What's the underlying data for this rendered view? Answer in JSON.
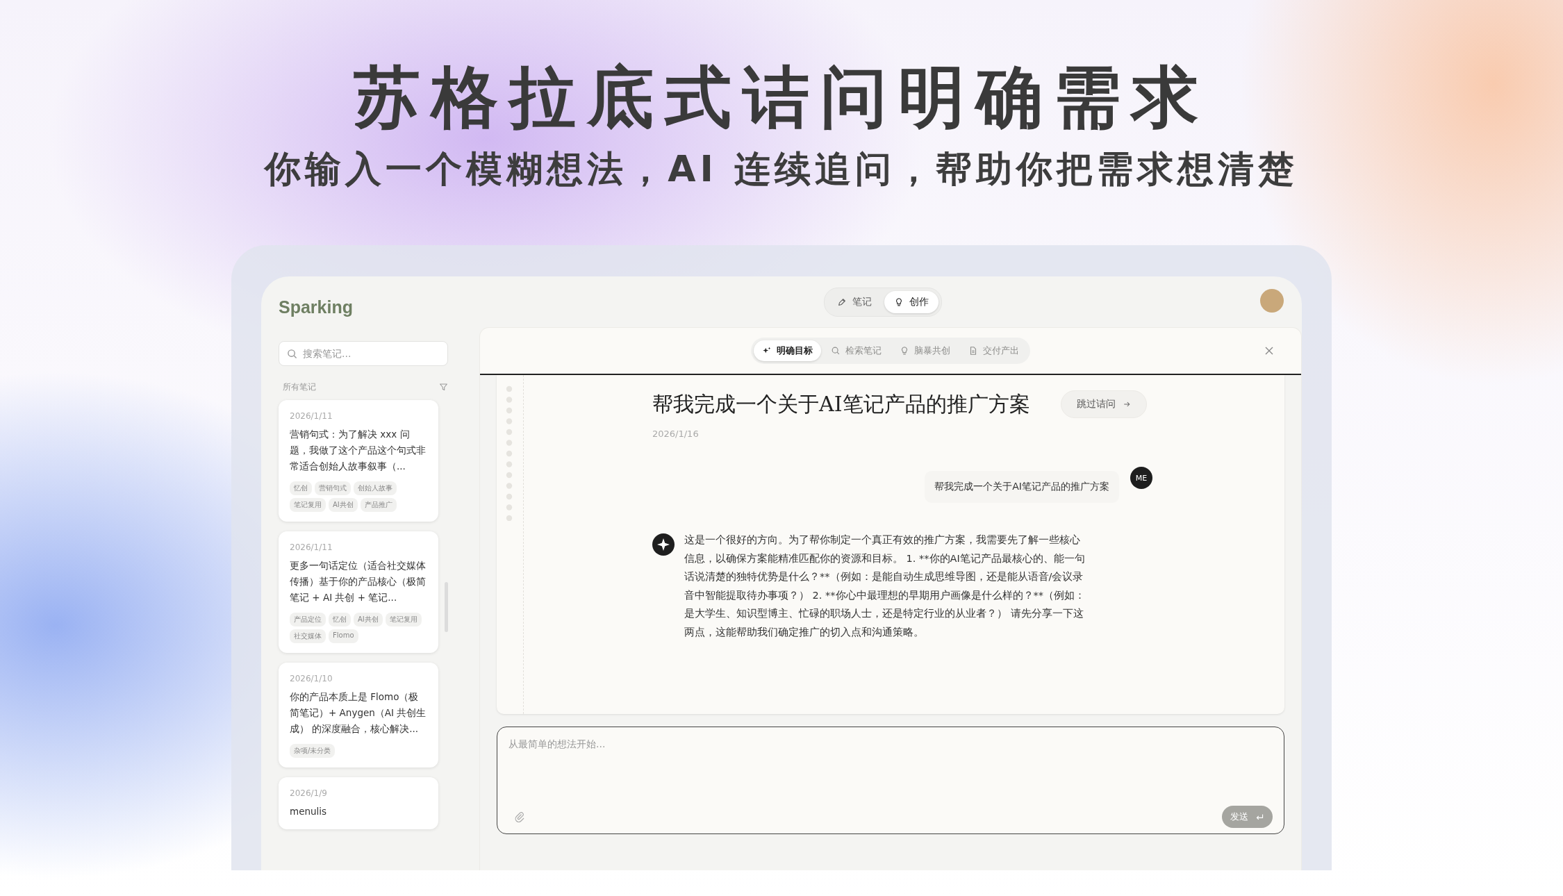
{
  "headline": "苏格拉底式诘问明确需求",
  "subheadline": "你输入一个模糊想法，AI 连续追问，帮助你把需求想清楚",
  "app": {
    "brand": "Sparking",
    "search": {
      "placeholder": "搜索笔记..."
    },
    "list_label": "所有笔记",
    "notes": [
      {
        "date": "2026/1/11",
        "excerpt": "营销句式：为了解决 xxx 问题，我做了这个产品这个句式非常适合创始人故事叙事（...",
        "tags": [
          "忆创",
          "营销句式",
          "创始人故事",
          "笔记复用",
          "AI共创",
          "产品推广"
        ]
      },
      {
        "date": "2026/1/11",
        "excerpt": "更多一句话定位（适合社交媒体传播）基于你的产品核心（极简笔记 + AI 共创 + 笔记...",
        "tags": [
          "产品定位",
          "忆创",
          "AI共创",
          "笔记复用",
          "社交媒体",
          "Flomo"
        ]
      },
      {
        "date": "2026/1/10",
        "excerpt": "你的产品本质上是 Flomo（极简笔记）+ Anygen（AI 共创生成） 的深度融合，核心解决...",
        "tags": [
          "杂项/未分类"
        ]
      },
      {
        "date": "2026/1/9",
        "excerpt": "menulis"
      }
    ],
    "mode_tabs": [
      {
        "label": "笔记",
        "selected": false
      },
      {
        "label": "创作",
        "selected": true
      }
    ],
    "steps": [
      {
        "label": "明确目标",
        "selected": true
      },
      {
        "label": "检索笔记",
        "selected": false
      },
      {
        "label": "脑暴共创",
        "selected": false
      },
      {
        "label": "交付产出",
        "selected": false
      }
    ],
    "document": {
      "title": "帮我完成一个关于AI笔记产品的推广方案",
      "date": "2026/1/16",
      "skip_button": "跳过诘问"
    },
    "messages": [
      {
        "kind": "user",
        "avatar": "ME",
        "text": "帮我完成一个关于AI笔记产品的推广方案"
      },
      {
        "kind": "assistant",
        "text": "这是一个很好的方向。为了帮你制定一个真正有效的推广方案，我需要先了解一些核心信息，以确保方案能精准匹配你的资源和目标。 1. **你的AI笔记产品最核心的、能一句话说清楚的独特优势是什么？**（例如：是能自动生成思维导图，还是能从语音/会议录音中智能提取待办事项？） 2. **你心中最理想的早期用户画像是什么样的？**（例如：是大学生、知识型博主、忙碌的职场人士，还是特定行业的从业者？） 请先分享一下这两点，这能帮助我们确定推广的切入点和沟通策略。"
      }
    ],
    "composer": {
      "placeholder": "从最简单的想法开始...",
      "send_button": "发送"
    }
  }
}
